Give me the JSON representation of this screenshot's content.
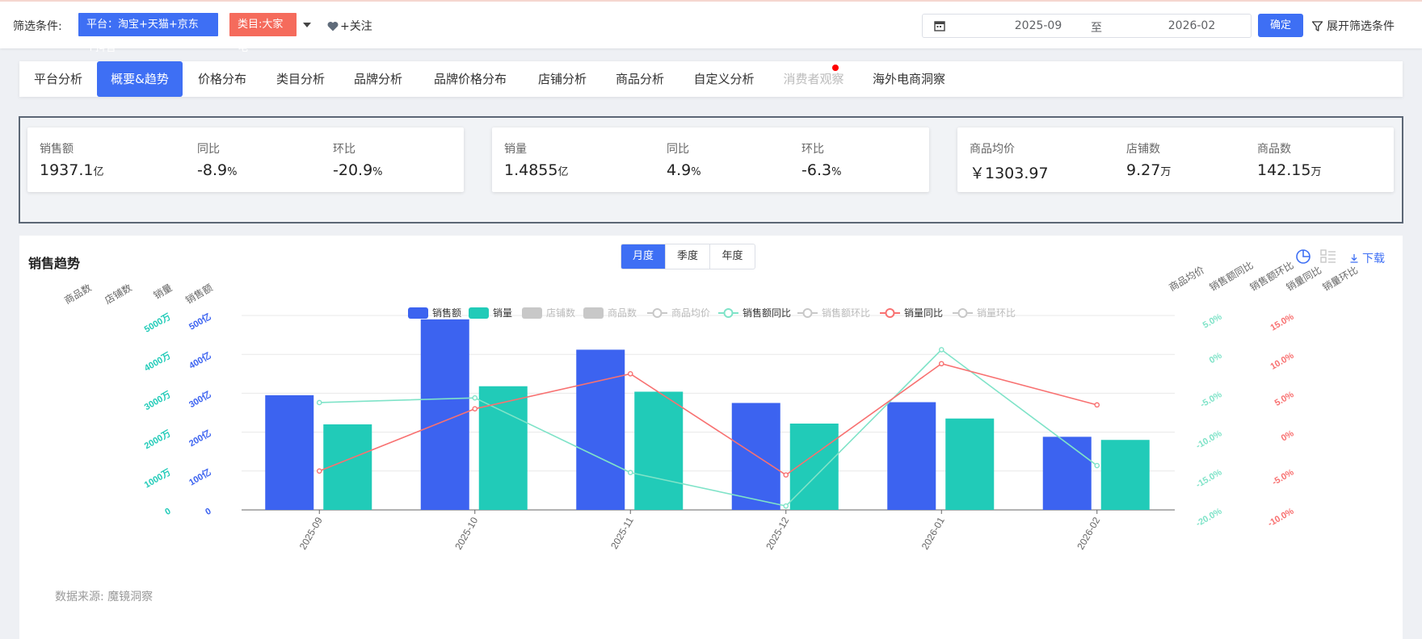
{
  "filter": {
    "label": "筛选条件:",
    "platform_tag": "平台：淘宝+天猫+京东+抖音",
    "category_tag": "类目:大家电",
    "follow_label": "+关注",
    "date_start": "2025-09",
    "date_to": "至",
    "date_end": "2026-02",
    "confirm_label": "确定",
    "expand_label": "展开筛选条件"
  },
  "tabs": [
    {
      "label": "平台分析",
      "state": "normal"
    },
    {
      "label": "概要&趋势",
      "state": "active"
    },
    {
      "label": "价格分布",
      "state": "normal"
    },
    {
      "label": "类目分析",
      "state": "normal"
    },
    {
      "label": "品牌分析",
      "state": "normal"
    },
    {
      "label": "品牌价格分布",
      "state": "normal"
    },
    {
      "label": "店铺分析",
      "state": "normal"
    },
    {
      "label": "商品分析",
      "state": "normal"
    },
    {
      "label": "自定义分析",
      "state": "normal"
    },
    {
      "label": "消费者观察",
      "state": "disabled"
    },
    {
      "label": "海外电商洞察",
      "state": "normal"
    }
  ],
  "stats": [
    [
      {
        "label": "销售额",
        "value": "1937.1",
        "unit": "亿"
      },
      {
        "label": "同比",
        "value": "-8.9",
        "unit": "%"
      },
      {
        "label": "环比",
        "value": "-20.9",
        "unit": "%"
      }
    ],
    [
      {
        "label": "销量",
        "value": "1.4855",
        "unit": "亿"
      },
      {
        "label": "同比",
        "value": "4.9",
        "unit": "%"
      },
      {
        "label": "环比",
        "value": "-6.3",
        "unit": "%"
      }
    ],
    [
      {
        "label": "商品均价",
        "value": "￥1303.97",
        "unit": ""
      },
      {
        "label": "店铺数",
        "value": "9.27",
        "unit": "万"
      },
      {
        "label": "商品数",
        "value": "142.15",
        "unit": "万"
      }
    ]
  ],
  "chart_section": {
    "title": "销售趋势",
    "periods": [
      "月度",
      "季度",
      "年度"
    ],
    "active_period": "月度",
    "download_label": "下载",
    "source": "数据来源: 魔镜洞察"
  },
  "colors": {
    "accent": "#3e6ff4",
    "sales": "#3c63f0",
    "volume": "#21cbb8",
    "sales_yoy": "#7fe3c8",
    "volume_yoy": "#f87171",
    "inactive": "#c8c8c8",
    "tag_red": "#f56b5c"
  },
  "chart_data": {
    "type": "bar",
    "categories": [
      "2025-09",
      "2025-10",
      "2025-11",
      "2025-12",
      "2026-01",
      "2026-02"
    ],
    "legend": [
      {
        "name": "销售额",
        "kind": "bar",
        "active": true
      },
      {
        "name": "销量",
        "kind": "bar",
        "active": true
      },
      {
        "name": "店铺数",
        "kind": "bar",
        "active": false
      },
      {
        "name": "商品数",
        "kind": "bar",
        "active": false
      },
      {
        "name": "商品均价",
        "kind": "line",
        "active": false
      },
      {
        "name": "销售额同比",
        "kind": "line",
        "active": true
      },
      {
        "name": "销售额环比",
        "kind": "line",
        "active": false
      },
      {
        "name": "销量同比",
        "kind": "line",
        "active": true
      },
      {
        "name": "销量环比",
        "kind": "line",
        "active": false
      }
    ],
    "series": [
      {
        "name": "销售额",
        "kind": "bar",
        "axis": "sales",
        "values": [
          295,
          490,
          412,
          275,
          277,
          188
        ]
      },
      {
        "name": "销量",
        "kind": "bar",
        "axis": "volume",
        "values": [
          2200,
          3180,
          3040,
          2220,
          2350,
          1800
        ]
      },
      {
        "name": "销售额同比",
        "kind": "line",
        "axis": "sales_yoy",
        "values": [
          -6.2,
          -5.6,
          -15.2,
          -19.5,
          0.6,
          -14.3
        ]
      },
      {
        "name": "销量同比",
        "kind": "line",
        "axis": "volume_yoy",
        "values": [
          -5.0,
          3.0,
          7.5,
          -5.5,
          8.8,
          3.5
        ]
      }
    ],
    "axes": {
      "left_titles": [
        "商品数",
        "店铺数",
        "销量",
        "销售额"
      ],
      "right_titles": [
        "商品均价",
        "销售额同比",
        "销售额环比",
        "销量同比",
        "销量环比"
      ],
      "sales": {
        "ticks": [
          "0",
          "100亿",
          "200亿",
          "300亿",
          "400亿",
          "500亿"
        ],
        "range": [
          0,
          500
        ]
      },
      "volume": {
        "ticks": [
          "0",
          "1000万",
          "2000万",
          "3000万",
          "4000万",
          "5000万"
        ],
        "range": [
          0,
          5000
        ]
      },
      "sales_yoy": {
        "ticks": [
          "-20.0%",
          "-15.0%",
          "-10.0%",
          "-5.0%",
          "0%",
          "5.0%"
        ],
        "range": [
          -20,
          5
        ]
      },
      "volume_yoy": {
        "ticks": [
          "-10.0%",
          "-5.0%",
          "0%",
          "5.0%",
          "10.0%",
          "15.0%"
        ],
        "range": [
          -10,
          15
        ]
      }
    },
    "grid": true
  }
}
